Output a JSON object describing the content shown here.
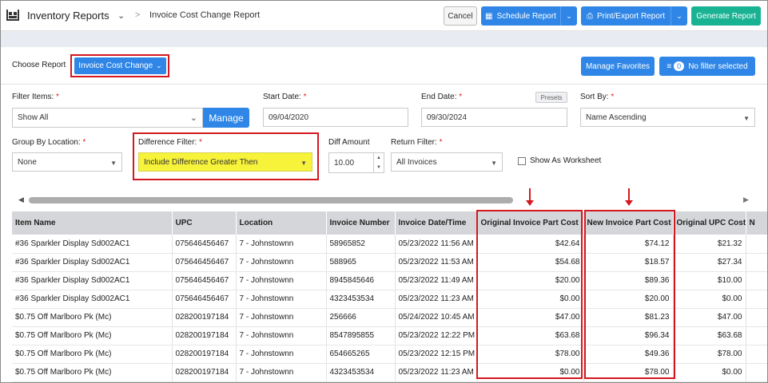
{
  "header": {
    "app_title": "Inventory Reports",
    "breadcrumb_sep": ">",
    "breadcrumb": "Invoice Cost Change Report",
    "cancel_label": "Cancel",
    "schedule_label": "Schedule Report",
    "print_label": "Print/Export Report",
    "generate_label": "Generate Report",
    "accent": "#2f86e6",
    "generate_color": "#19b394"
  },
  "choose": {
    "label": "Choose Report",
    "selected": "Invoice Cost Change",
    "manage_favorites": "Manage Favorites",
    "filter_count": "0",
    "filter_text": "No filter selected"
  },
  "filters": {
    "filter_items_label": "Filter Items:",
    "filter_items_value": "Show All",
    "manage_label": "Manage",
    "start_label": "Start Date:",
    "start_value": "09/04/2020",
    "end_label": "End Date:",
    "end_value": "09/30/2024",
    "presets_label": "Presets",
    "sort_label": "Sort By:",
    "sort_value": "Name Ascending",
    "group_label": "Group By Location:",
    "group_value": "None",
    "diff_filter_label": "Difference Filter:",
    "diff_filter_value": "Include Difference Greater Then",
    "diff_amount_label": "Diff Amount",
    "diff_amount_value": "10.00",
    "return_label": "Return Filter:",
    "return_value": "All Invoices",
    "worksheet_label": "Show As Worksheet",
    "required_mark": "*"
  },
  "table": {
    "columns": [
      "Item Name",
      "UPC",
      "Location",
      "Invoice Number",
      "Invoice Date/Time",
      "Original Invoice Part Cost",
      "New Invoice Part Cost",
      "Original UPC Cost",
      "N"
    ],
    "rows": [
      [
        "#36 Sparkler Display Sd002AC1",
        "075646456467",
        "7 - Johnstownn",
        "58965852",
        "05/23/2022 11:56 AM",
        "$42.64",
        "$74.12",
        "$21.32",
        ""
      ],
      [
        "#36 Sparkler Display Sd002AC1",
        "075646456467",
        "7 - Johnstownn",
        "588965",
        "05/23/2022 11:53 AM",
        "$54.68",
        "$18.57",
        "$27.34",
        ""
      ],
      [
        "#36 Sparkler Display Sd002AC1",
        "075646456467",
        "7 - Johnstownn",
        "8945845646",
        "05/23/2022 11:49 AM",
        "$20.00",
        "$89.36",
        "$10.00",
        ""
      ],
      [
        "#36 Sparkler Display Sd002AC1",
        "075646456467",
        "7 - Johnstownn",
        "4323453534",
        "05/23/2022 11:23 AM",
        "$0.00",
        "$20.00",
        "$0.00",
        ""
      ],
      [
        "$0.75 Off Marlboro Pk (Mc)",
        "028200197184",
        "7 - Johnstownn",
        "256666",
        "05/24/2022 10:45 AM",
        "$47.00",
        "$81.23",
        "$47.00",
        ""
      ],
      [
        "$0.75 Off Marlboro Pk (Mc)",
        "028200197184",
        "7 - Johnstownn",
        "8547895855",
        "05/23/2022 12:22 PM",
        "$63.68",
        "$96.34",
        "$63.68",
        ""
      ],
      [
        "$0.75 Off Marlboro Pk (Mc)",
        "028200197184",
        "7 - Johnstownn",
        "654665265",
        "05/23/2022 12:15 PM",
        "$78.00",
        "$49.36",
        "$78.00",
        ""
      ],
      [
        "$0.75 Off Marlboro Pk (Mc)",
        "028200197184",
        "7 - Johnstownn",
        "4323453534",
        "05/23/2022 11:23 AM",
        "$0.00",
        "$78.00",
        "$0.00",
        ""
      ]
    ]
  }
}
